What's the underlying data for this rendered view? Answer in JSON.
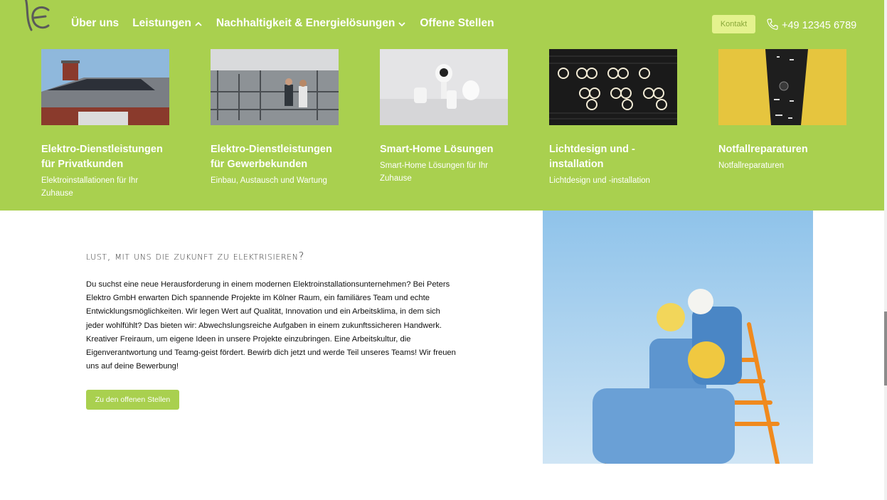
{
  "nav": {
    "items": [
      {
        "label": "Über uns",
        "dropdown": false
      },
      {
        "label": "Leistungen",
        "dropdown": true,
        "icon": "chevron-up-icon"
      },
      {
        "label": "Nachhaltigkeit & Energielösungen",
        "dropdown": true,
        "icon": "chevron-down-icon"
      },
      {
        "label": "Offene Stellen",
        "dropdown": false
      }
    ],
    "contact_label": "Kontakt",
    "phone": "+49 12345 6789",
    "phone_icon": "phone-icon",
    "logo_icon": "logo-icon"
  },
  "services": [
    {
      "title": "Elektro-Dienstleistungen für Privatkunden",
      "subtitle": "Elektroinstallationen für Ihr Zuhause",
      "image": "house-solar-roof-image"
    },
    {
      "title": "Elektro-Dienstleistungen für Gewerbekunden",
      "subtitle": "Einbau, Austausch und Wartung",
      "image": "industrial-workshop-image"
    },
    {
      "title": "Smart-Home Lösungen",
      "subtitle": "Smart-Home Lösungen für Ihr Zuhause",
      "image": "smart-home-devices-image"
    },
    {
      "title": "Lichtdesign und -installation",
      "subtitle": "Lichtdesign und -installation",
      "image": "led-light-panel-image"
    },
    {
      "title": "Notfallreparaturen",
      "subtitle": "Notfallreparaturen",
      "image": "wire-stripper-tool-image"
    }
  ],
  "careers": {
    "headline": "Lust, mit uns die Zukunft zu elektrisieren?",
    "body": "Du suchst eine neue Herausforderung in einem modernen Elektroinstallationsunternehmen? Bei Peters Elektro GmbH erwarten Dich spannende Projekte im Kölner Raum, ein familiäres Team und echte Entwicklungsmöglichkeiten. Wir legen Wert auf Qualität, Innovation und ein Arbeitsklima, in dem sich jeder wohlfühlt? Das bieten wir: Abwechslungsreiche Aufgaben in einem zukunftssicheren Handwerk. Kreativer Freiraum, um eigene Ideen in unsere Projekte einzubringen. Eine Arbeitskultur, die Eigenverantwortung und Teamg-geist fördert. Bewirb dich jetzt und werde Teil unseres Teams! Wir freuen uns auf deine Bewerbung!",
    "button_label": "Zu den offenen Stellen",
    "image": "workers-climbing-stairs-image"
  },
  "colors": {
    "brand_green": "#a9d04f",
    "contact_button": "#e4f28e",
    "white": "#ffffff"
  }
}
